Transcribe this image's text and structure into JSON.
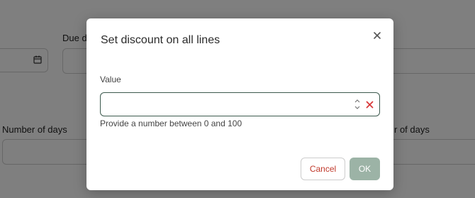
{
  "background": {
    "due_date_label": "Due da",
    "number_of_days_left_label": "Number of days",
    "number_of_days_right_label": "r of days"
  },
  "modal": {
    "title": "Set discount on all lines",
    "value_label": "Value",
    "value_input": "",
    "helper_text": "Provide a number between 0 and 100",
    "cancel_label": "Cancel",
    "ok_label": "OK"
  },
  "colors": {
    "input_border": "#3d5a4e",
    "cancel_text": "#c0392b",
    "ok_background": "#9cb3a6",
    "clear_icon": "#d9383a"
  },
  "icons": {
    "close": "close-icon",
    "stepper": "stepper-arrows-icon",
    "clear": "clear-x-icon",
    "calendar": "calendar-icon"
  }
}
